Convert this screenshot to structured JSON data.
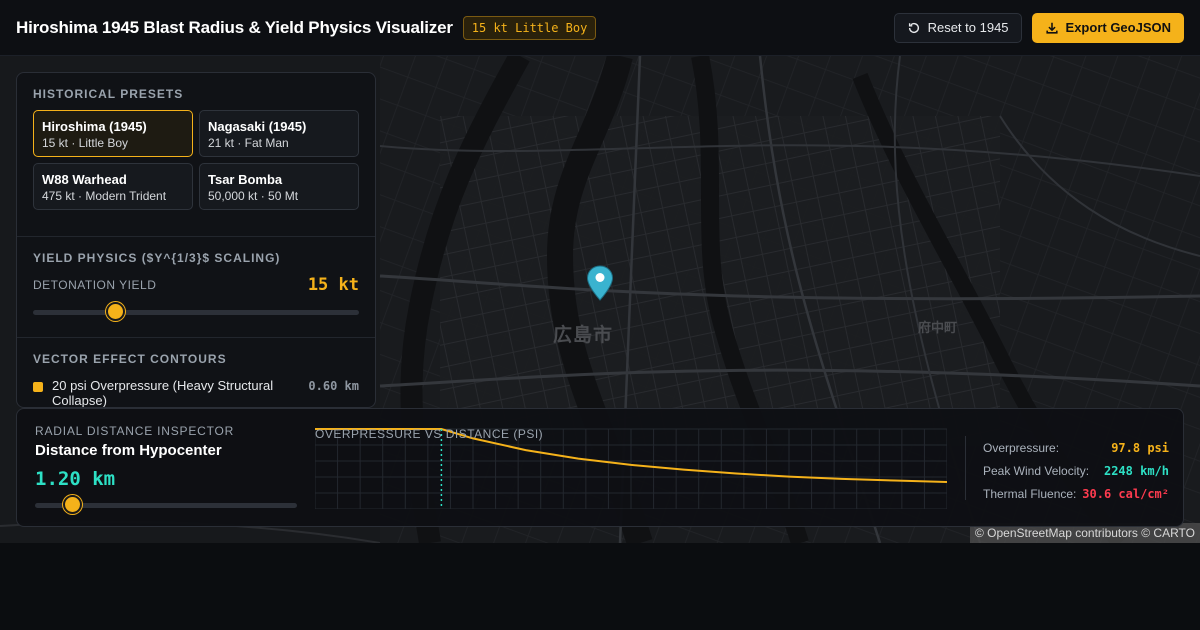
{
  "header": {
    "title": "Hiroshima 1945 Blast Radius & Yield Physics Visualizer",
    "badge": "15 kt Little Boy",
    "reset_label": "Reset to 1945",
    "export_label": "Export GeoJSON"
  },
  "map": {
    "place_main": "広島市",
    "place_east": "府中町",
    "attribution": "© OpenStreetMap contributors © CARTO",
    "pin_icon": "map-pin-icon"
  },
  "presets_panel": {
    "title": "HISTORICAL PRESETS",
    "presets": [
      {
        "name": "Hiroshima (1945)",
        "desc": "15 kt · Little Boy",
        "active": true
      },
      {
        "name": "Nagasaki (1945)",
        "desc": "21 kt · Fat Man",
        "active": false
      },
      {
        "name": "W88 Warhead",
        "desc": "475 kt · Modern Trident",
        "active": false
      },
      {
        "name": "Tsar Bomba",
        "desc": "50,000 kt · 50 Mt",
        "active": false
      }
    ]
  },
  "yield_panel": {
    "title": "YIELD PHYSICS ($Y^{1/3}$ SCALING)",
    "label": "DETONATION YIELD",
    "value": "15 kt",
    "slider_fraction": 0.25
  },
  "contours_panel": {
    "title": "VECTOR EFFECT CONTOURS",
    "items": [
      {
        "label": "20 psi Overpressure (Heavy Structural Collapse)",
        "value": "0.60 km",
        "color": "#f5b21a"
      }
    ]
  },
  "inspector": {
    "kicker": "RADIAL DISTANCE INSPECTOR",
    "title": "Distance from Hypocenter",
    "value": "1.20 km",
    "slider_fraction": 0.14
  },
  "chart_data": {
    "type": "line",
    "title": "OVERPRESSURE VS DISTANCE (PSI)",
    "xlabel": "",
    "ylabel": "",
    "grid": true,
    "legend": "none",
    "series": [
      {
        "x": [
          0,
          0.4,
          0.8,
          1.0,
          1.2,
          1.5,
          2.0,
          2.5,
          3.0,
          3.5,
          4.0,
          4.5,
          5.0,
          5.5,
          6.0
        ],
        "y": [
          100,
          100,
          100,
          100,
          100,
          88,
          73,
          62,
          54,
          48,
          43,
          39,
          36,
          34,
          32
        ],
        "color": "#f5b21a"
      }
    ],
    "marker_x": 1.2,
    "xlim": [
      0,
      6
    ],
    "ylim": [
      0,
      100
    ],
    "marker_color": "#2de0c5"
  },
  "metrics": [
    {
      "label": "Overpressure:",
      "value": "97.8 psi",
      "color": "#f5b21a"
    },
    {
      "label": "Peak Wind Velocity:",
      "value": "2248 km/h",
      "color": "#2de0c5"
    },
    {
      "label": "Thermal Fluence:",
      "value": "30.6 cal/cm²",
      "color": "#ff3b4f"
    }
  ]
}
